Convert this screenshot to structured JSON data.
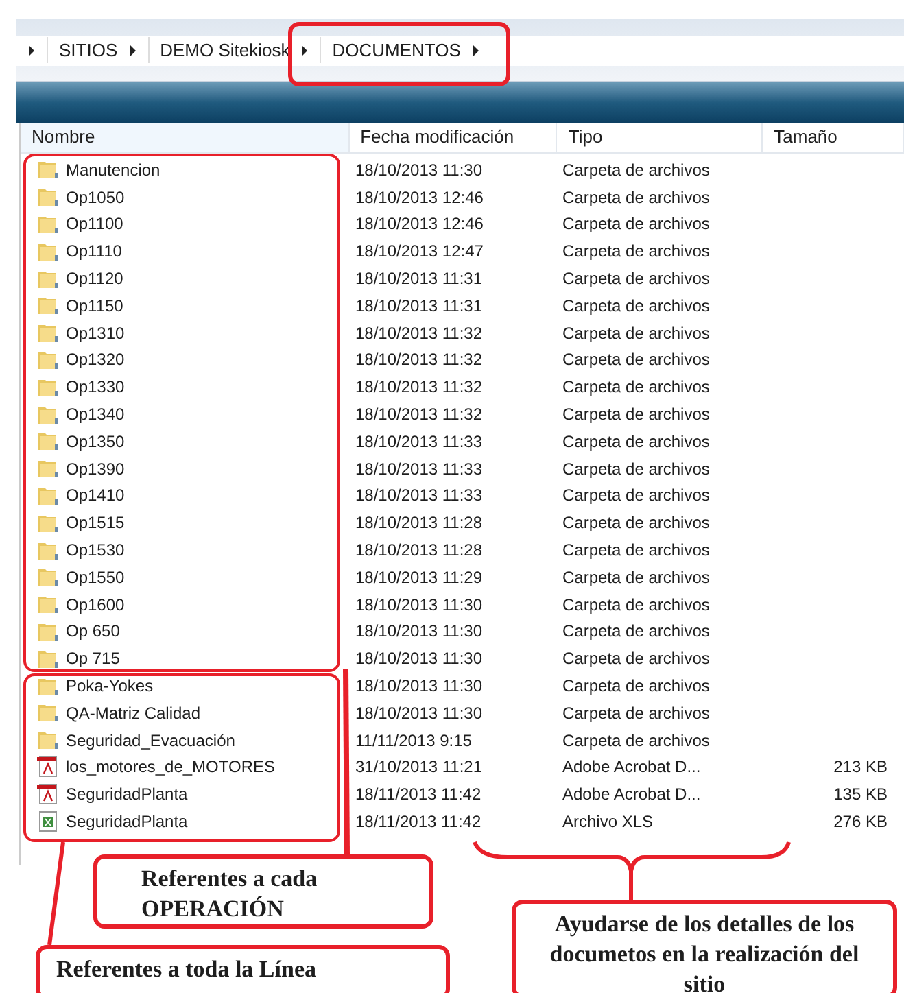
{
  "breadcrumb": [
    {
      "label": "SITIOS"
    },
    {
      "label": "DEMO Sitekiosk"
    },
    {
      "label": "DOCUMENTOS"
    }
  ],
  "table": {
    "columns": [
      "Nombre",
      "Fecha modificación",
      "Tipo",
      "Tamaño"
    ],
    "rows": [
      {
        "kind": "folder",
        "name": "Manutencion",
        "date": "18/10/2013 11:30",
        "type": "Carpeta de archivos"
      },
      {
        "kind": "folder",
        "name": "Op1050",
        "date": "18/10/2013 12:46",
        "type": "Carpeta de archivos"
      },
      {
        "kind": "folder",
        "name": "Op1100",
        "date": "18/10/2013 12:46",
        "type": "Carpeta de archivos"
      },
      {
        "kind": "folder",
        "name": "Op1110",
        "date": "18/10/2013 12:47",
        "type": "Carpeta de archivos"
      },
      {
        "kind": "folder",
        "name": "Op1120",
        "date": "18/10/2013 11:31",
        "type": "Carpeta de archivos"
      },
      {
        "kind": "folder",
        "name": "Op1150",
        "date": "18/10/2013 11:31",
        "type": "Carpeta de archivos"
      },
      {
        "kind": "folder",
        "name": "Op1310",
        "date": "18/10/2013 11:32",
        "type": "Carpeta de archivos"
      },
      {
        "kind": "folder",
        "name": "Op1320",
        "date": "18/10/2013 11:32",
        "type": "Carpeta de archivos"
      },
      {
        "kind": "folder",
        "name": "Op1330",
        "date": "18/10/2013 11:32",
        "type": "Carpeta de archivos"
      },
      {
        "kind": "folder",
        "name": "Op1340",
        "date": "18/10/2013 11:32",
        "type": "Carpeta de archivos"
      },
      {
        "kind": "folder",
        "name": "Op1350",
        "date": "18/10/2013 11:33",
        "type": "Carpeta de archivos"
      },
      {
        "kind": "folder",
        "name": "Op1390",
        "date": "18/10/2013 11:33",
        "type": "Carpeta de archivos"
      },
      {
        "kind": "folder",
        "name": "Op1410",
        "date": "18/10/2013 11:33",
        "type": "Carpeta de archivos"
      },
      {
        "kind": "folder",
        "name": "Op1515",
        "date": "18/10/2013 11:28",
        "type": "Carpeta de archivos"
      },
      {
        "kind": "folder",
        "name": "Op1530",
        "date": "18/10/2013 11:28",
        "type": "Carpeta de archivos"
      },
      {
        "kind": "folder",
        "name": "Op1550",
        "date": "18/10/2013 11:29",
        "type": "Carpeta de archivos"
      },
      {
        "kind": "folder",
        "name": "Op1600",
        "date": "18/10/2013 11:30",
        "type": "Carpeta de archivos"
      },
      {
        "kind": "folder",
        "name": "Op 650",
        "date": "18/10/2013 11:30",
        "type": "Carpeta de archivos"
      },
      {
        "kind": "folder",
        "name": "Op 715",
        "date": "18/10/2013 11:30",
        "type": "Carpeta de archivos"
      },
      {
        "kind": "folder",
        "name": "Poka-Yokes",
        "date": "18/10/2013 11:30",
        "type": "Carpeta de archivos"
      },
      {
        "kind": "folder",
        "name": "QA-Matriz Calidad",
        "date": "18/10/2013 11:30",
        "type": "Carpeta de archivos"
      },
      {
        "kind": "folder",
        "name": "Seguridad_Evacuación",
        "date": "11/11/2013 9:15",
        "type": "Carpeta de archivos"
      },
      {
        "kind": "pdf",
        "name": "los_motores_de_MOTORES",
        "date": "31/10/2013 11:21",
        "type": "Adobe Acrobat D...",
        "size": "213 KB"
      },
      {
        "kind": "pdf",
        "name": "SeguridadPlanta",
        "date": "18/11/2013 11:42",
        "type": "Adobe Acrobat D...",
        "size": "135 KB"
      },
      {
        "kind": "xls",
        "name": "SeguridadPlanta",
        "date": "18/11/2013 11:42",
        "type": "Archivo XLS",
        "size": "276 KB"
      }
    ]
  },
  "callouts": [
    {
      "kind": "operation",
      "text": "Referentes a cada OPERACIÓN"
    },
    {
      "kind": "line",
      "text": "Referentes a toda la Línea"
    },
    {
      "kind": "details",
      "text": "Ayudarse de los detalles de los documetos en la realización del sitio"
    }
  ]
}
